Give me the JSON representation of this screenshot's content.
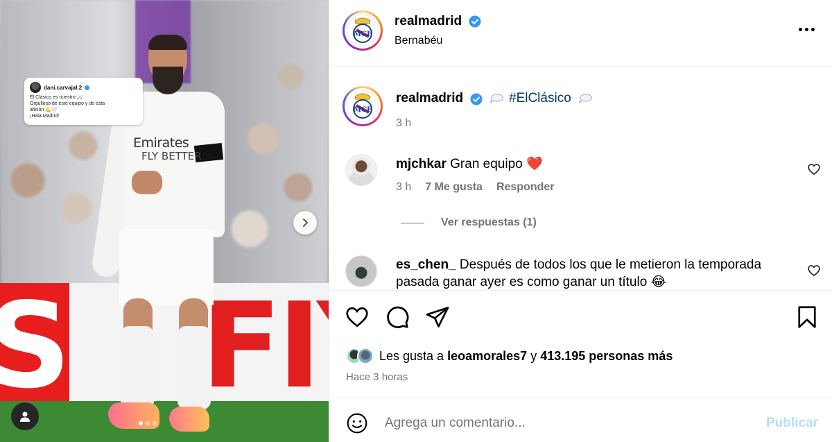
{
  "post": {
    "username": "realmadrid",
    "location": "Bernabéu"
  },
  "story_card": {
    "username": "dani.carvajal.2",
    "lines": [
      "El Clásico es nuestro ⚔️",
      "Orgulloso de este equipo y de esta",
      "afición 💪🤍",
      "¡Hala Madrid!"
    ]
  },
  "photo": {
    "sponsor": "Emirates",
    "sponsor_sub": "FLY BETTER",
    "board_left": "S",
    "board_right": "FIY"
  },
  "caption": {
    "username": "realmadrid",
    "hashtag": "#ElClásico",
    "time": "3 h"
  },
  "comments": [
    {
      "username": "mjchkar",
      "text": "Gran equipo ❤️",
      "time": "3 h",
      "likes": "7 Me gusta",
      "reply": "Responder",
      "view_replies": "Ver respuestas (1)"
    },
    {
      "username": "es_chen_",
      "text": "Después de todos los que le metieron la temporada pasada ganar ayer es como ganar un título 😂"
    }
  ],
  "likes": {
    "prefix": "Les gusta a",
    "user": "leoamorales7",
    "connector": "y",
    "others": "413.195 personas más"
  },
  "time_ago": "Hace 3 horas",
  "add_comment": {
    "placeholder": "Agrega un comentario...",
    "publish": "Publicar"
  },
  "colors": {
    "verified": "#3797f0",
    "hashtag": "#00376b",
    "muted": "#737373",
    "publish_disabled": "#b2dffc"
  },
  "icons": [
    "chevron-right-icon",
    "user-tag-icon",
    "more-icon",
    "verified-icon",
    "speech-bubble-icon",
    "heart-icon",
    "comment-icon",
    "share-icon",
    "bookmark-icon",
    "emoji-icon"
  ]
}
